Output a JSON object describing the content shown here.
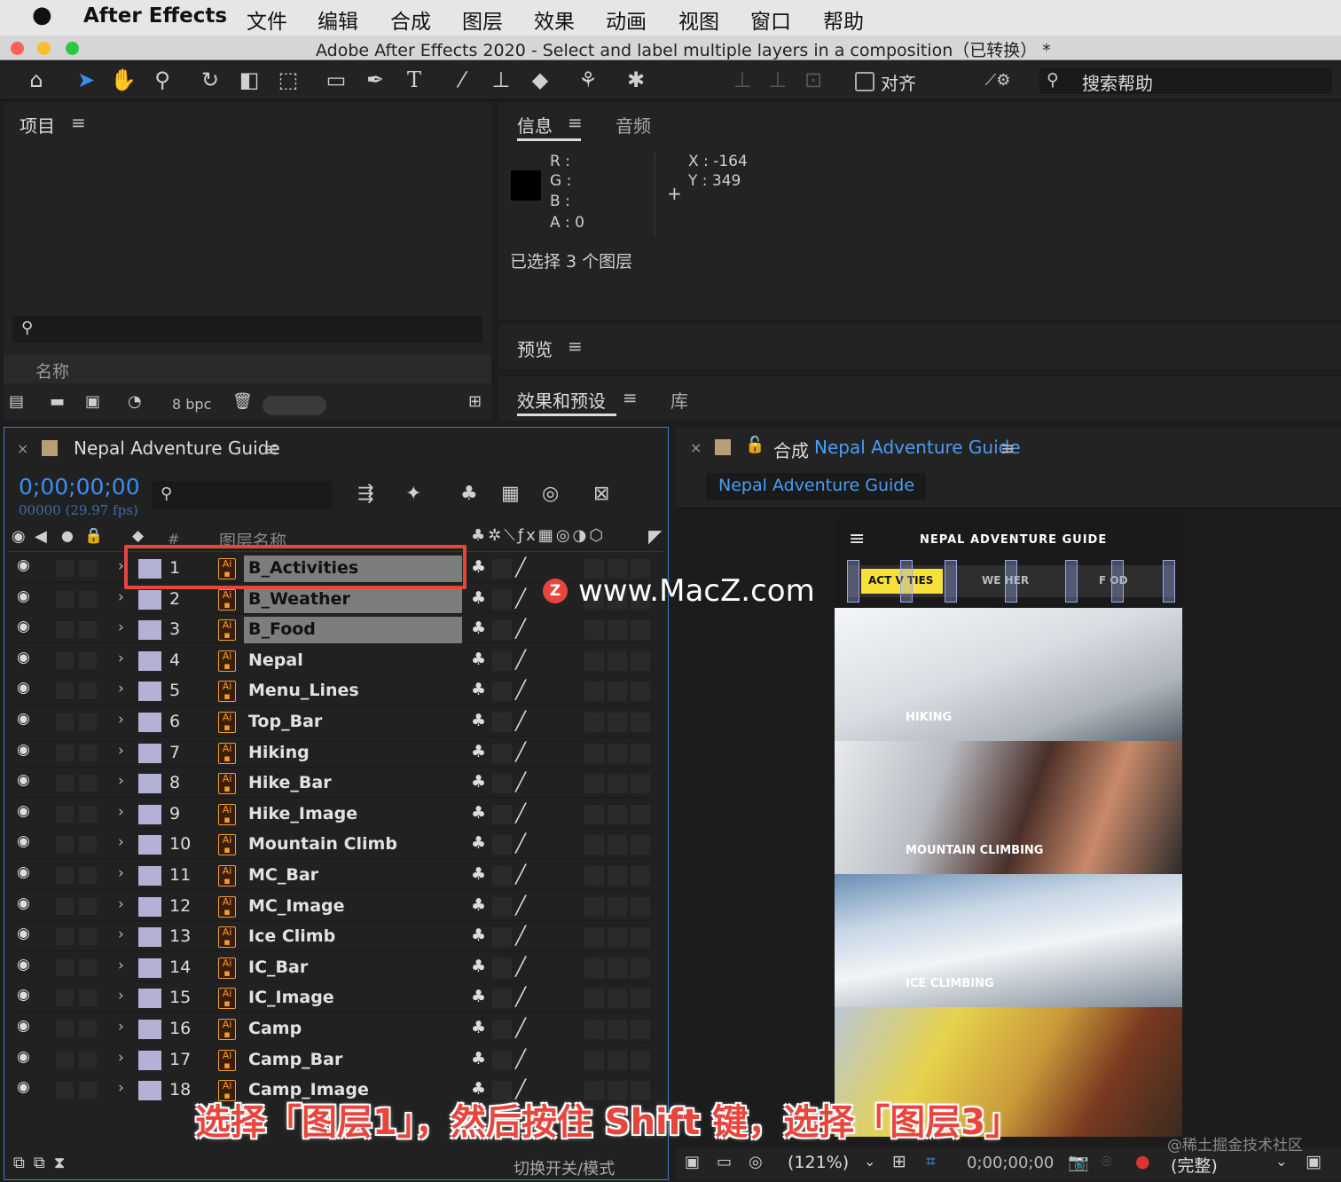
{
  "menubar": {
    "apple": "",
    "app": "After Effects",
    "items": [
      "文件",
      "编辑",
      "合成",
      "图层",
      "效果",
      "动画",
      "视图",
      "窗口",
      "帮助"
    ]
  },
  "window": {
    "title": "Adobe After Effects 2020 - Select and label multiple layers in a composition（已转换） *"
  },
  "toolbar": {
    "align_label": "对齐",
    "search_help": "搜索帮助"
  },
  "project": {
    "title": "项目",
    "name_col": "名称",
    "bpc": "8 bpc"
  },
  "info": {
    "tab_info": "信息",
    "tab_audio": "音频",
    "r": "R :",
    "g": "G :",
    "b": "B :",
    "a": "A :  0",
    "x": "X : -164",
    "y": "Y :  349",
    "selected": "已选择 3 个图层",
    "swatch_color": "#000000"
  },
  "preview": {
    "title": "预览"
  },
  "effects": {
    "tab_effects": "效果和预设",
    "tab_library": "库"
  },
  "timeline": {
    "comp_name": "Nepal Adventure Guide",
    "timecode": "0;00;00;00",
    "frames": "00000 (29.97 fps)",
    "col_num": "#",
    "col_name": "图层名称",
    "toggle_label": "切换开关/模式",
    "layers": [
      {
        "n": "1",
        "name": "B_Activities",
        "sel": true
      },
      {
        "n": "2",
        "name": "B_Weather",
        "sel": true
      },
      {
        "n": "3",
        "name": "B_Food",
        "sel": true
      },
      {
        "n": "4",
        "name": "Nepal",
        "sel": false
      },
      {
        "n": "5",
        "name": "Menu_Lines",
        "sel": false
      },
      {
        "n": "6",
        "name": "Top_Bar",
        "sel": false
      },
      {
        "n": "7",
        "name": "Hiking",
        "sel": false
      },
      {
        "n": "8",
        "name": "Hike_Bar",
        "sel": false
      },
      {
        "n": "9",
        "name": "Hike_Image",
        "sel": false
      },
      {
        "n": "10",
        "name": "Mountain Climb",
        "sel": false
      },
      {
        "n": "11",
        "name": "MC_Bar",
        "sel": false
      },
      {
        "n": "12",
        "name": "MC_Image",
        "sel": false
      },
      {
        "n": "13",
        "name": "Ice Climb",
        "sel": false
      },
      {
        "n": "14",
        "name": "IC_Bar",
        "sel": false
      },
      {
        "n": "15",
        "name": "IC_Image",
        "sel": false
      },
      {
        "n": "16",
        "name": "Camp",
        "sel": false
      },
      {
        "n": "17",
        "name": "Camp_Bar",
        "sel": false
      },
      {
        "n": "18",
        "name": "Camp_Image",
        "sel": false
      }
    ]
  },
  "composition": {
    "label": "合成",
    "name": "Nepal Adventure Guide",
    "tab": "Nepal Adventure Guide",
    "zoom": "(121%)",
    "timecode": "0;00;00;00",
    "quality": "(完整)"
  },
  "preview_app": {
    "title": "NEPAL ADVENTURE GUIDE",
    "nav": [
      "ACT  V  TIES",
      "WE   HER",
      "F  OD"
    ],
    "sections": [
      "HIKING",
      "MOUNTAIN CLIMBING",
      "ICE CLIMBING"
    ]
  },
  "overlay": {
    "watermark": "www.MacZ.com",
    "caption": "选择「图层1」，然后按住 Shift 键，选择「图层3」",
    "credit": "@稀土掘金技术社区"
  }
}
